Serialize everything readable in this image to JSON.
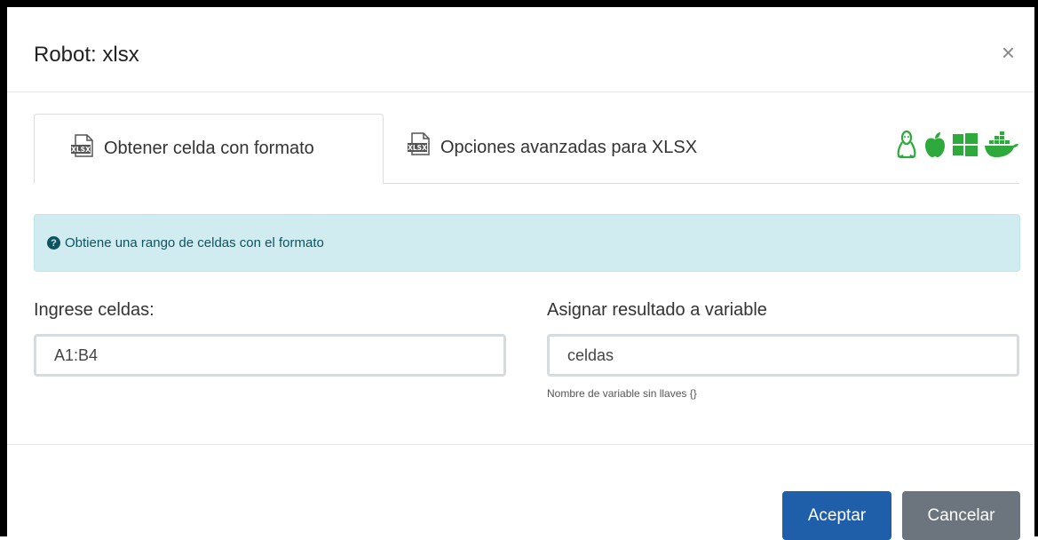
{
  "modal": {
    "title": "Robot: xlsx",
    "close_symbol": "×"
  },
  "tabs": [
    {
      "label": "Obtener celda con formato",
      "icon": "xlsx-file-icon",
      "active": true
    },
    {
      "label": "Opciones avanzadas para XLSX",
      "icon": "xlsx-file-icon",
      "active": false
    }
  ],
  "os_icons": [
    "linux-icon",
    "apple-icon",
    "windows-icon",
    "docker-icon"
  ],
  "colors": {
    "os_icon": "#2eaa3c",
    "alert_bg": "#d1ecf1",
    "primary": "#1f5ea8",
    "secondary": "#6c757d"
  },
  "alert": {
    "icon": "question-circle-icon",
    "text": "Obtiene una rango de celdas con el formato"
  },
  "form": {
    "cells_label": "Ingrese celdas:",
    "cells_value": "A1:B4",
    "variable_label": "Asignar resultado a variable",
    "variable_value": "celdas",
    "variable_help": "Nombre de variable sin llaves {}"
  },
  "footer": {
    "accept_label": "Aceptar",
    "cancel_label": "Cancelar"
  }
}
